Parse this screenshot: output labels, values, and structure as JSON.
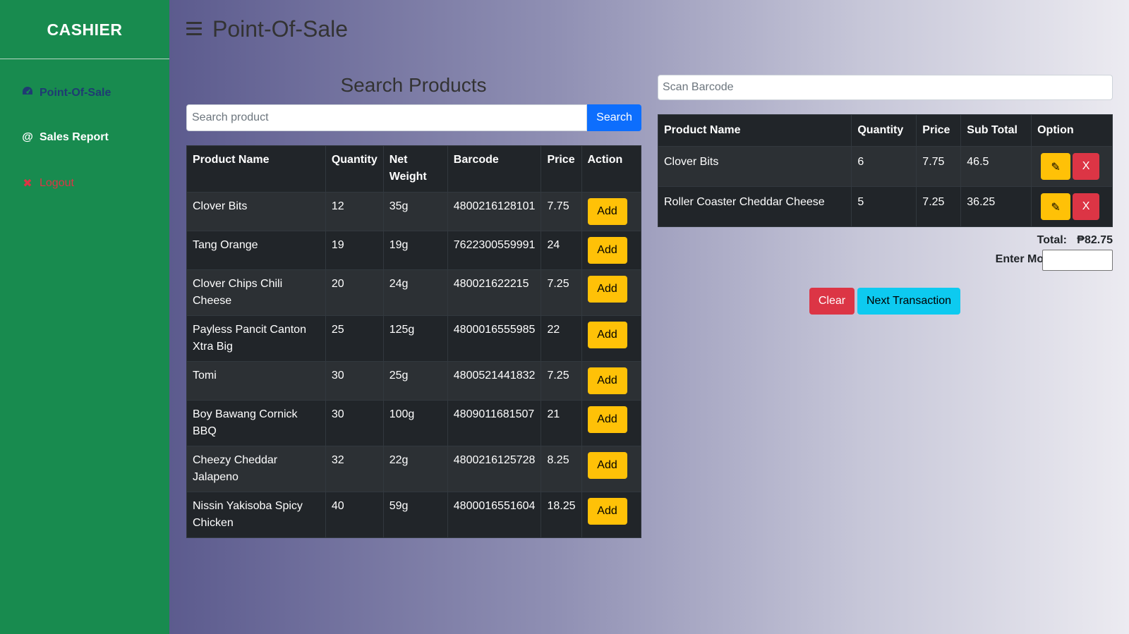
{
  "sidebar": {
    "brand": "CASHIER",
    "items": [
      {
        "label": "Point-Of-Sale",
        "icon": "dashboard-icon"
      },
      {
        "label": "Sales Report",
        "icon": "at-icon"
      },
      {
        "label": "Logout",
        "icon": "x-icon"
      }
    ]
  },
  "header": {
    "title": "Point-Of-Sale"
  },
  "search": {
    "heading": "Search Products",
    "placeholder": "Search product",
    "button": "Search"
  },
  "products": {
    "columns": [
      "Product Name",
      "Quantity",
      "Net Weight",
      "Barcode",
      "Price",
      "Action"
    ],
    "rows": [
      {
        "name": "Clover Bits",
        "quantity": "12",
        "weight": "35g",
        "barcode": "4800216128101",
        "price": "7.75",
        "action": "Add"
      },
      {
        "name": "Tang Orange",
        "quantity": "19",
        "weight": "19g",
        "barcode": "7622300559991",
        "price": "24",
        "action": "Add"
      },
      {
        "name": "Clover Chips Chili Cheese",
        "quantity": "20",
        "weight": "24g",
        "barcode": "480021622215",
        "price": "7.25",
        "action": "Add"
      },
      {
        "name": "Payless Pancit Canton Xtra Big",
        "quantity": "25",
        "weight": "125g",
        "barcode": "4800016555985",
        "price": "22",
        "action": "Add"
      },
      {
        "name": "Tomi",
        "quantity": "30",
        "weight": "25g",
        "barcode": "4800521441832",
        "price": "7.25",
        "action": "Add"
      },
      {
        "name": "Boy Bawang Cornick BBQ",
        "quantity": "30",
        "weight": "100g",
        "barcode": "4809011681507",
        "price": "21",
        "action": "Add"
      },
      {
        "name": "Cheezy Cheddar Jalapeno",
        "quantity": "32",
        "weight": "22g",
        "barcode": "4800216125728",
        "price": "8.25",
        "action": "Add"
      },
      {
        "name": "Nissin Yakisoba Spicy Chicken",
        "quantity": "40",
        "weight": "59g",
        "barcode": "4800016551604",
        "price": "18.25",
        "action": "Add"
      }
    ]
  },
  "cart": {
    "barcode_placeholder": "Scan Barcode",
    "columns": [
      "Product Name",
      "Quantity",
      "Price",
      "Sub Total",
      "Option"
    ],
    "rows": [
      {
        "name": "Clover Bits",
        "quantity": "6",
        "price": "7.75",
        "subtotal": "46.5",
        "edit_icon": "pencil-icon",
        "delete_label": "X"
      },
      {
        "name": "Roller Coaster Cheddar Cheese",
        "quantity": "5",
        "price": "7.25",
        "subtotal": "36.25",
        "edit_icon": "pencil-icon",
        "delete_label": "X"
      }
    ],
    "total_label": "Total:",
    "total_value": "₱82.75",
    "money_label": "Enter Money:",
    "money_value": "",
    "clear_button": "Clear",
    "next_button": "Next Transaction"
  },
  "colors": {
    "sidebar_bg": "#188b4f",
    "add_button": "#ffc107",
    "clear_button": "#dc3545",
    "next_button": "#0dcaf0",
    "search_button": "#0d6efd",
    "table_dark": "#212529"
  }
}
